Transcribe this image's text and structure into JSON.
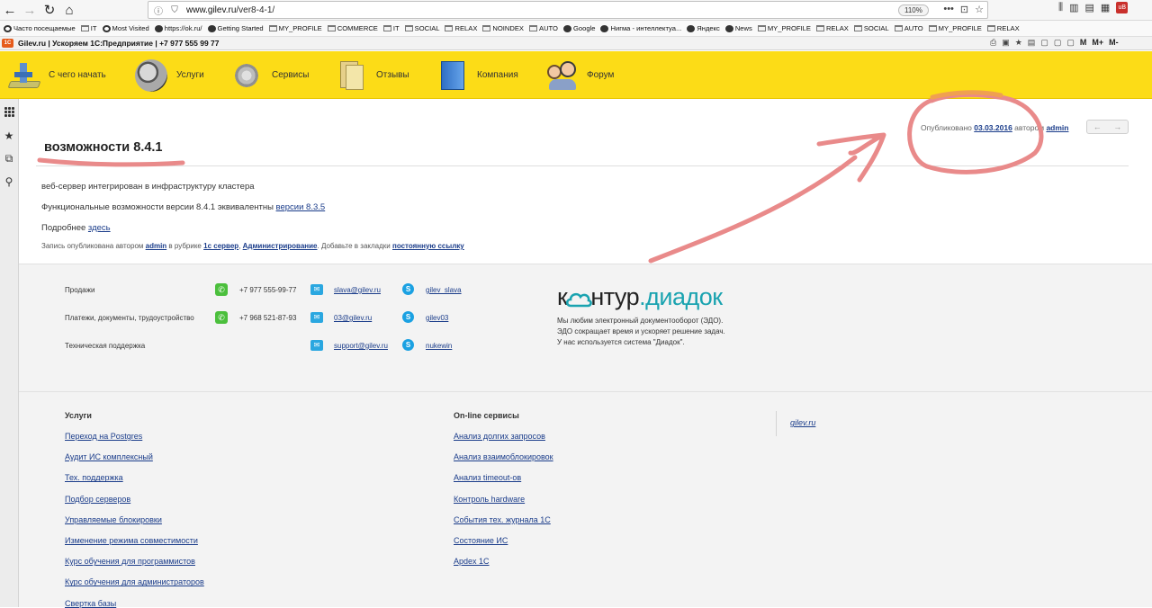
{
  "browser": {
    "back": "←",
    "forward": "→",
    "reload": "↻",
    "home": "⌂",
    "url_domain": "www.gilev.ru",
    "url_path": "/ver8-4-1/",
    "zoom": "110%",
    "menu_dots": "•••"
  },
  "bookmarks": [
    {
      "label": "Часто посещаемые",
      "icon": "gear"
    },
    {
      "label": "IT",
      "icon": "folder"
    },
    {
      "label": "Most Visited",
      "icon": "gear"
    },
    {
      "label": "https://ok.ru/",
      "icon": "globe"
    },
    {
      "label": "Getting Started",
      "icon": "globe"
    },
    {
      "label": "MY_PROFILE",
      "icon": "folder"
    },
    {
      "label": "COMMERCE",
      "icon": "folder"
    },
    {
      "label": "IT",
      "icon": "folder"
    },
    {
      "label": "SOCIAL",
      "icon": "folder"
    },
    {
      "label": "RELAX",
      "icon": "folder"
    },
    {
      "label": "NOINDEX",
      "icon": "folder"
    },
    {
      "label": "AUTO",
      "icon": "folder"
    },
    {
      "label": "Google",
      "icon": "globe"
    },
    {
      "label": "Нигма - интеллектуа...",
      "icon": "globe"
    },
    {
      "label": "Яндекс",
      "icon": "globe"
    },
    {
      "label": "News",
      "icon": "globe"
    },
    {
      "label": "MY_PROFILE",
      "icon": "folder"
    },
    {
      "label": "RELAX",
      "icon": "folder"
    },
    {
      "label": "SOCIAL",
      "icon": "folder"
    },
    {
      "label": "AUTO",
      "icon": "folder"
    },
    {
      "label": "MY_PROFILE",
      "icon": "folder"
    },
    {
      "label": "RELAX",
      "icon": "folder"
    }
  ],
  "addon": {
    "site_title": "Gilev.ru | Ускоряем 1С:Предприятие | +7 977 555 99 77",
    "logo": "1С",
    "tools": [
      "M",
      "M+",
      "M-"
    ]
  },
  "nav": [
    {
      "label": "С чего начать"
    },
    {
      "label": "Услуги"
    },
    {
      "label": "Сервисы"
    },
    {
      "label": "Отзывы"
    },
    {
      "label": "Компания"
    },
    {
      "label": "Форум"
    }
  ],
  "post": {
    "meta_prefix": "Опубликовано",
    "date": "03.03.2016",
    "meta_by": "автором",
    "author": "admin",
    "title": "возможности 8.4.1",
    "p1": "веб-сервер интегрирован в инфраструктуру кластера",
    "p2_text": "Функциональные возможности версии 8.4.1 эквивалентны",
    "p2_link": "версии 8.3.5",
    "p3_text": "Подробнее",
    "p3_link": "здесь",
    "note_1": "Запись опубликована автором",
    "note_author": "admin",
    "note_2": "в рубрике",
    "note_cat1": "1с сервер",
    "note_comma": ",",
    "note_cat2": "Администрирование",
    "note_3": ". Добавьте в закладки",
    "note_link": "постоянную ссылку",
    "pager_prev": "←",
    "pager_next": "→"
  },
  "contacts": [
    {
      "label": "Продажи",
      "phone": "+7 977 555-99-77",
      "email": "slava@gilev.ru",
      "skype": "gilev_slava"
    },
    {
      "label": "Платежи, документы, трудоустройство",
      "phone": "+7 968 521-87-93",
      "email": "03@gilev.ru",
      "skype": "gilev03"
    },
    {
      "label": "Техническая поддержка",
      "phone": "",
      "email": "support@gilev.ru",
      "skype": "nukewin"
    }
  ],
  "diadoc": {
    "logo_left": "к",
    "logo_mid": "нтур",
    "logo_dot": ".",
    "logo_right": "диадок",
    "line1": "Мы любим электронный документооборот (ЭДО).",
    "line2": "ЭДО сокращает время и ускоряет решение задач.",
    "line3": "У нас используется система \"Диадок\"."
  },
  "footer": {
    "col1_title": "Услуги",
    "col1": [
      "Переход на Postgres",
      "Аудит ИС комплексный",
      "Тех. поддержка",
      "Подбор серверов",
      "Управляемые блокировки",
      "Изменение режима совместимости",
      "Курс обучения для программистов",
      "Курс обучения для администраторов",
      "Свертка базы"
    ],
    "col2_title": "On-line сервисы",
    "col2": [
      "Анализ долгих запросов",
      "Анализ взаимоблокировок",
      "Анализ timeout-ов",
      "Контроль hardware",
      "События тех. журнала 1С",
      "Состояние ИС",
      "Apdex 1C"
    ],
    "site": "gilev.ru"
  },
  "colors": {
    "nav_yellow": "#fcdc17",
    "link": "#1a3c8a",
    "annotation": "#e98a8a",
    "annotation_orange": "#f0a050"
  }
}
